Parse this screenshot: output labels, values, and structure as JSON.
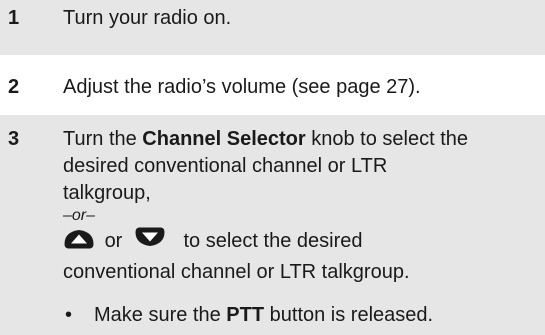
{
  "steps": [
    {
      "number": "1",
      "text": "Turn your radio on."
    },
    {
      "number": "2",
      "text": "Adjust the radio’s volume (see page 27)."
    },
    {
      "number": "3",
      "text_before": "Turn the ",
      "text_bold": "Channel Selector",
      "text_after_line1": " knob to select the",
      "line2": "desired conventional channel or LTR",
      "line3": "talkgroup,",
      "or_label": "–or–",
      "or_word": "or",
      "icon_text": "to select the desired",
      "line_last": "conventional channel or LTR talkgroup.",
      "up_icon": "up-arrow-button-icon",
      "down_icon": "down-arrow-button-icon"
    }
  ],
  "bullet": {
    "symbol": "•",
    "text_before": "Make sure the ",
    "text_bold": "PTT",
    "text_after": " button is released."
  }
}
